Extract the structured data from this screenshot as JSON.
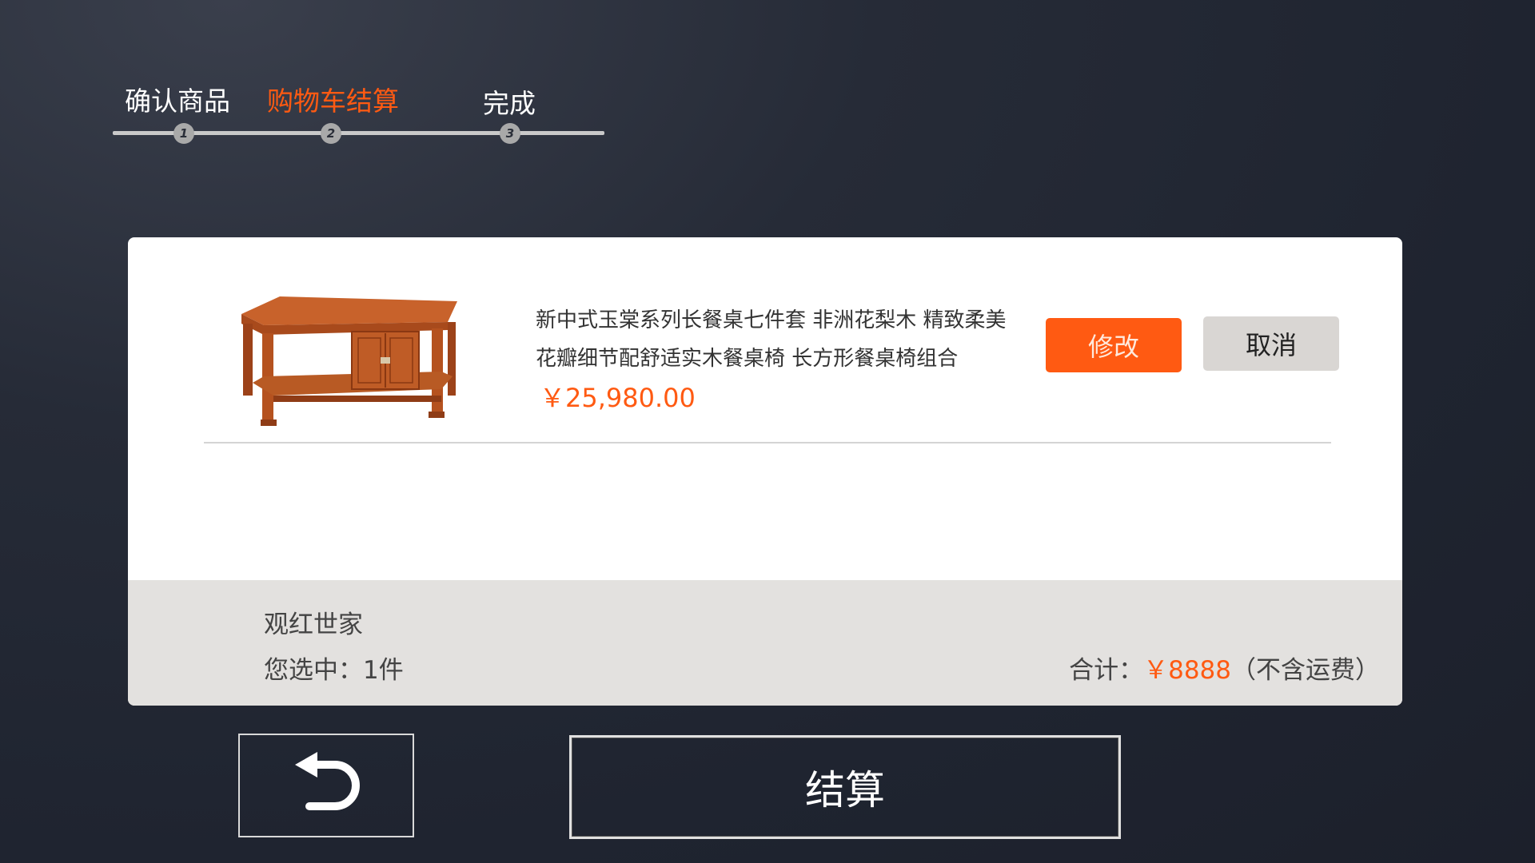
{
  "stepper": {
    "steps": [
      {
        "label": "确认商品",
        "number": "1"
      },
      {
        "label": "购物车结算",
        "number": "2"
      },
      {
        "label": "完成",
        "number": "3"
      }
    ],
    "active_step": 2,
    "active_color": "#ff5a12"
  },
  "cart": {
    "item": {
      "name": "新中式玉棠系列长餐桌七件套 非洲花梨木 精致柔美花瓣细节配舒适实木餐桌椅 长方形餐桌椅组合",
      "price": "￥25,980.00",
      "image_icon": "rosewood-coffee-table-image"
    },
    "modify_label": "修改",
    "cancel_label": "取消"
  },
  "summary": {
    "shop_name": "观红世家",
    "selected_text": "您选中：1件",
    "total_prefix": "合计：",
    "total_amount": "￥8888",
    "total_suffix": "（不含运费）"
  },
  "actions": {
    "back_icon": "undo-arrow-icon",
    "checkout_label": "结算"
  },
  "colors": {
    "accent": "#ff5a12",
    "background": "#1f2430",
    "card": "#ffffff",
    "summary_bg": "#e3e1df"
  }
}
